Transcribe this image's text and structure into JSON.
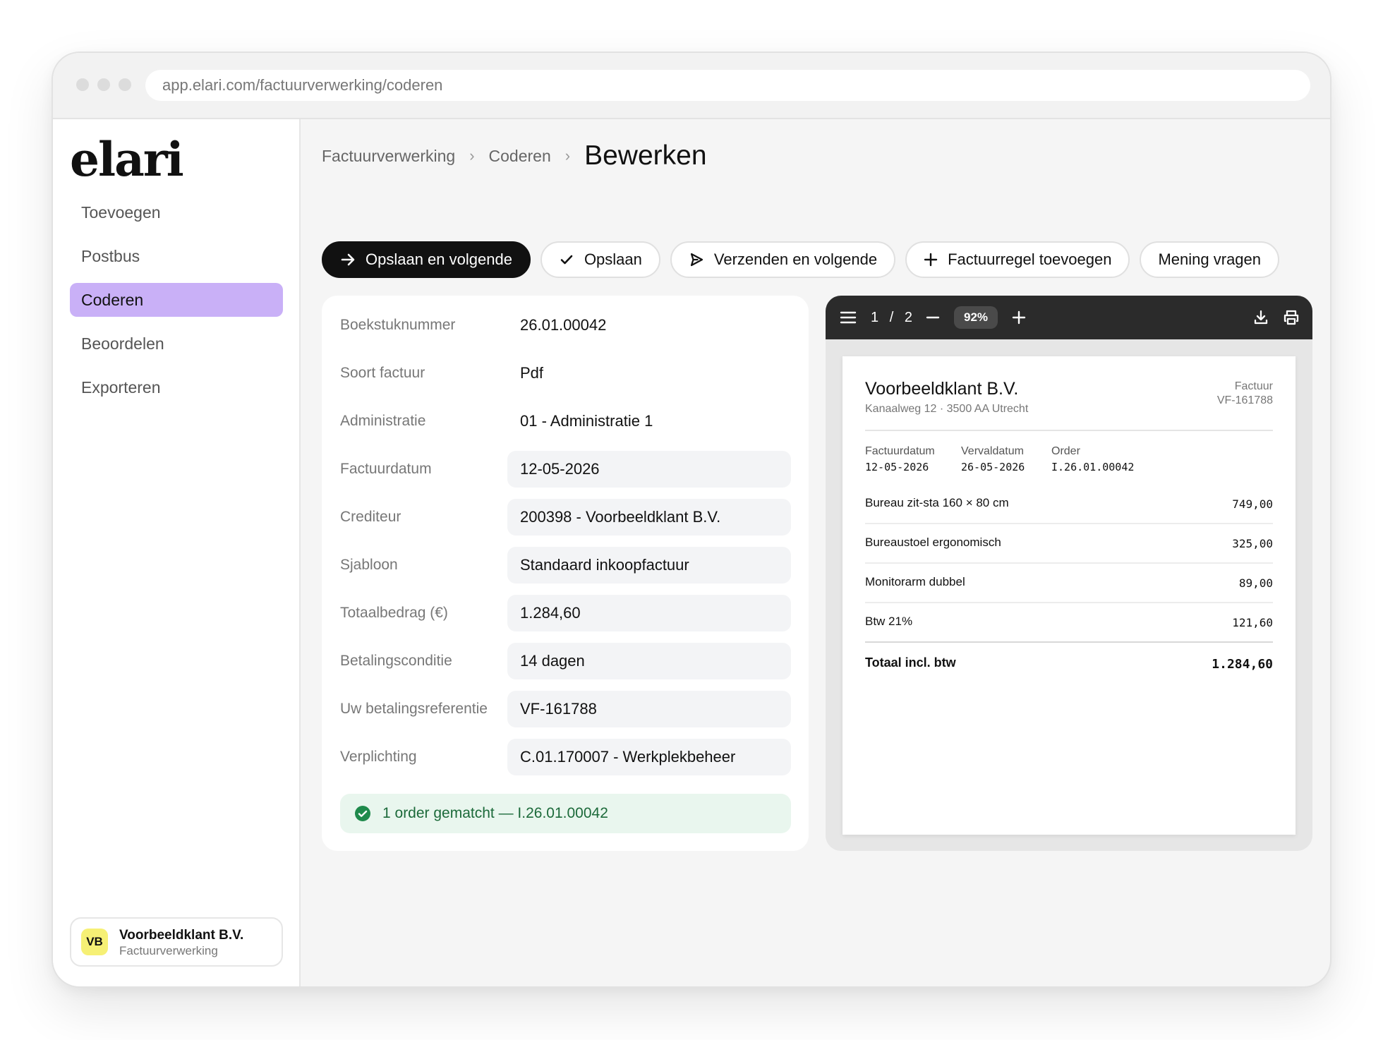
{
  "browser": {
    "url": "app.elari.com/factuurverwerking/coderen"
  },
  "sidebar": {
    "logo": "elari",
    "items": [
      {
        "label": "Toevoegen"
      },
      {
        "label": "Postbus"
      },
      {
        "label": "Coderen",
        "active": true
      },
      {
        "label": "Beoordelen"
      },
      {
        "label": "Exporteren"
      }
    ],
    "account": {
      "initials": "VB",
      "name": "Voorbeeldklant B.V.",
      "subtitle": "Factuurverwerking"
    }
  },
  "breadcrumb": {
    "items": [
      "Factuurverwerking",
      "Coderen"
    ],
    "current": "Bewerken"
  },
  "toolbar": {
    "save_next": "Opslaan en volgende",
    "save": "Opslaan",
    "send_next": "Verzenden en volgende",
    "add_line": "Factuurregel toevoegen",
    "ask_opinion": "Mening vragen"
  },
  "form": {
    "fields": [
      {
        "label": "Boekstuknummer",
        "value": "26.01.00042"
      },
      {
        "label": "Soort factuur",
        "value": "Pdf"
      },
      {
        "label": "Administratie",
        "value": "01 - Administratie 1"
      },
      {
        "label": "Factuurdatum",
        "value": "12-05-2026"
      },
      {
        "label": "Crediteur",
        "value": "200398 - Voorbeeldklant B.V."
      },
      {
        "label": "Sjabloon",
        "value": "Standaard inkoopfactuur"
      },
      {
        "label": "Totaalbedrag (€)",
        "value": "1.284,60"
      },
      {
        "label": "Betalingsconditie",
        "value": "14 dagen"
      },
      {
        "label": "Uw betalingsreferentie",
        "value": "VF-161788"
      },
      {
        "label": "Verplichting",
        "value": "C.01.170007 - Werkplekbeheer"
      }
    ],
    "match_status": "1 order gematcht — I.26.01.00042"
  },
  "viewer": {
    "page_current": "1",
    "page_separator": "/",
    "page_total": "2",
    "zoom": "92%",
    "invoice": {
      "company": "Voorbeeldklant B.V.",
      "address": "Kanaalweg 12 · 3500 AA Utrecht",
      "doc_type": "Factuur",
      "doc_number": "VF-161788",
      "meta": [
        {
          "label": "Factuurdatum",
          "value": "12-05-2026"
        },
        {
          "label": "Vervaldatum",
          "value": "26-05-2026"
        },
        {
          "label": "Order",
          "value": "I.26.01.00042"
        }
      ],
      "lines": [
        {
          "desc": "Bureau zit-sta 160 × 80 cm",
          "amount": "749,00"
        },
        {
          "desc": "Bureaustoel ergonomisch",
          "amount": "325,00"
        },
        {
          "desc": "Monitorarm dubbel",
          "amount": "89,00"
        },
        {
          "desc": "Btw 21%",
          "amount": "121,60"
        }
      ],
      "total_label": "Totaal incl. btw",
      "total_amount": "1.284,60"
    }
  },
  "colors": {
    "accent_active_nav": "#c9b0f7",
    "primary_button": "#111111",
    "success_bg": "#e9f6ee",
    "success_text": "#1c6a3a",
    "avatar_bg": "#f6f075",
    "viewer_toolbar": "#2b2b2b"
  },
  "icons": {
    "save_next": "arrow-right-icon",
    "save": "check-icon",
    "send_next": "send-icon",
    "add_line": "plus-icon",
    "match": "check-circle-icon",
    "viewer": [
      "menu-icon",
      "zoom-out-icon",
      "zoom-in-icon",
      "download-icon",
      "print-icon"
    ]
  }
}
